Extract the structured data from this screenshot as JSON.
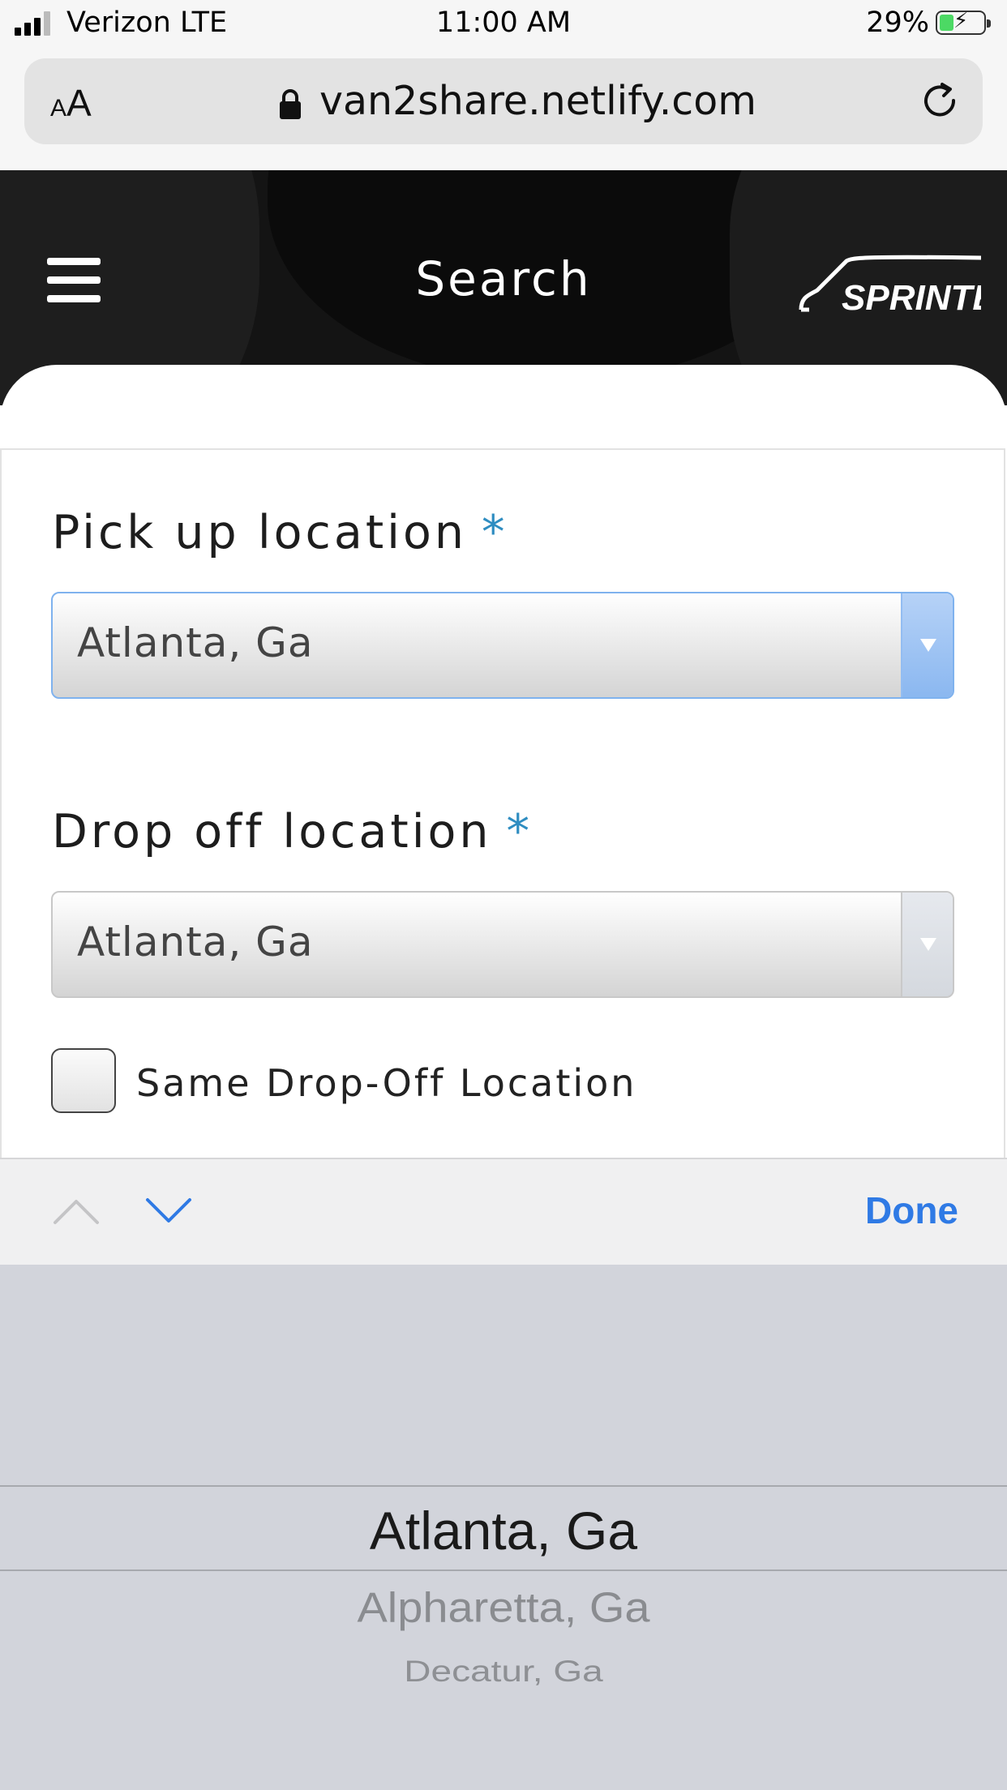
{
  "status_bar": {
    "carrier": "Verizon LTE",
    "time": "11:00 AM",
    "battery_percent": "29%"
  },
  "browser": {
    "text_size_label": "AA",
    "url": "van2share.netlify.com"
  },
  "header": {
    "title": "Search",
    "brand": "SPRINTER"
  },
  "form": {
    "pickup": {
      "label": "Pick up location",
      "required_mark": "*",
      "value": "Atlanta, Ga"
    },
    "dropoff": {
      "label": "Drop off location",
      "required_mark": "*",
      "value": "Atlanta, Ga"
    },
    "same_dropoff": {
      "label": "Same Drop-Off Location",
      "checked": false
    }
  },
  "accessory": {
    "done_label": "Done"
  },
  "picker": {
    "options": [
      "Atlanta, Ga",
      "Alpharetta, Ga",
      "Decatur, Ga"
    ],
    "selected": "Atlanta, Ga"
  }
}
